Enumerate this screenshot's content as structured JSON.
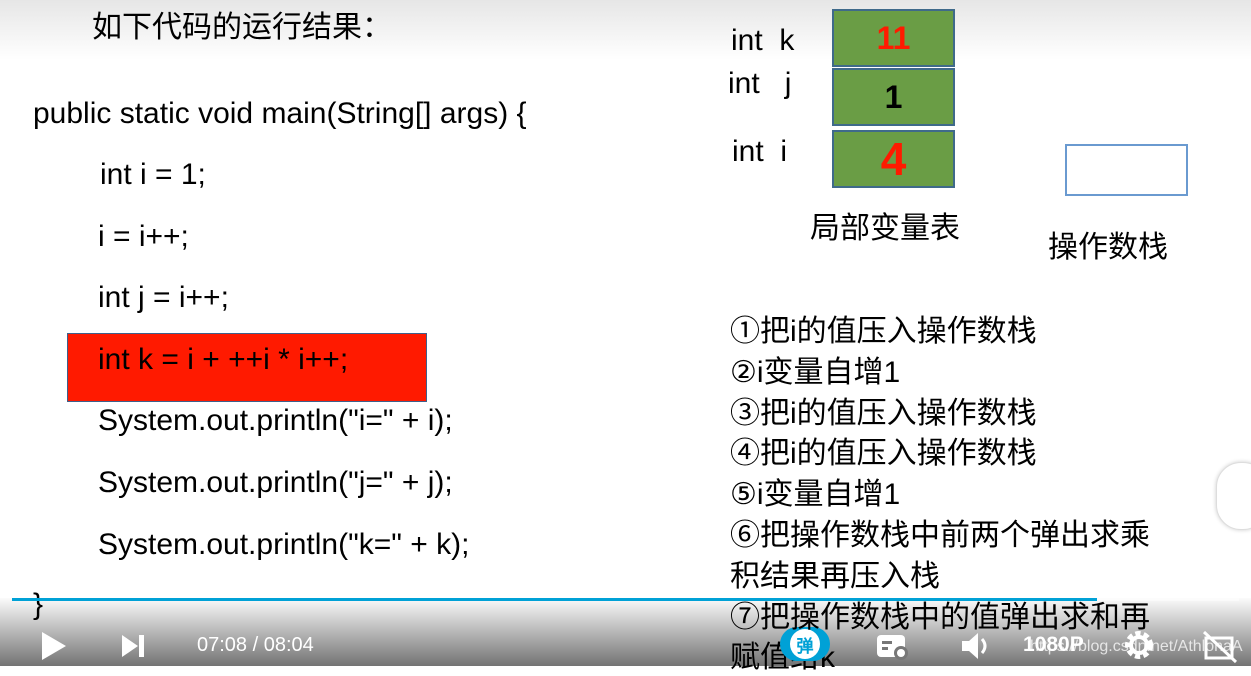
{
  "slide": {
    "title": "如下代码的运行结果：",
    "code": [
      "public static void main(String[] args) {",
      "int i = 1;",
      "i = i++;",
      "int j = i++;",
      "int k = i + ++i * i++;",
      "System.out.println(\"i=\" + i);",
      "System.out.println(\"j=\" + j);",
      "System.out.println(\"k=\" + k);",
      "}"
    ],
    "highlight_color": "#ff1a00",
    "variables": [
      {
        "label": "int  k",
        "value": "11",
        "value_color": "#ff1a00"
      },
      {
        "label": "int   j",
        "value": "1",
        "value_color": "#000000"
      },
      {
        "label": "int  i",
        "value": "4",
        "value_color": "#ff1a00"
      }
    ],
    "cell_color": "#6a9d45",
    "local_var_table_caption": "局部变量表",
    "operand_stack_caption": "操作数栈",
    "steps": [
      "①把i的值压入操作数栈",
      "②i变量自增1",
      "③把i的值压入操作数栈",
      "④把i的值压入操作数栈",
      "⑤i变量自增1",
      "⑥把操作数栈中前两个弹出求乘",
      "积结果再压入栈",
      "⑦把操作数栈中的值弹出求和再",
      "赋值给k"
    ]
  },
  "player": {
    "current_time": "07:08",
    "separator": "/",
    "duration": "08:04",
    "progress_percent": 88.4,
    "accent_color": "#00a1d6",
    "danmaku_label": "弹",
    "quality_label": "1080P",
    "watermark": "https://blog.csdn.net/AthlonaA",
    "icons": [
      "play-icon",
      "next-icon",
      "danmaku-settings-icon",
      "volume-icon",
      "settings-icon",
      "fullscreen-exit-icon"
    ]
  }
}
